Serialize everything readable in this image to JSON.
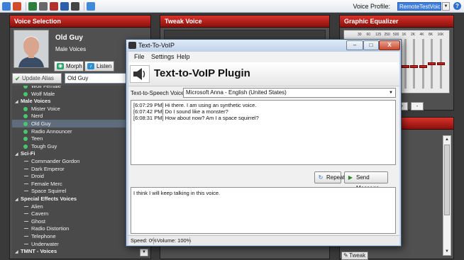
{
  "toolbar": {
    "voice_profile_label": "Voice Profile:",
    "voice_profile_value": "RemoteTestVoice",
    "help_label": "?"
  },
  "voice_panel": {
    "title": "Voice Selection",
    "voice_name": "Old Guy",
    "voice_category": "Male Voices",
    "morph_label": "Morph",
    "listen_label": "Listen",
    "update_alias_label": "Update Alias",
    "alias_value": "Old Guy",
    "tree": [
      {
        "type": "leaf",
        "label": "Wolf Female",
        "icon": "dot"
      },
      {
        "type": "leaf",
        "label": "Wolf Male",
        "icon": "dot"
      },
      {
        "type": "group",
        "label": "Male Voices"
      },
      {
        "type": "leaf",
        "label": "Mister Voice",
        "icon": "dot"
      },
      {
        "type": "leaf",
        "label": "Nerd",
        "icon": "dot"
      },
      {
        "type": "leaf",
        "label": "Old Guy",
        "icon": "dot",
        "selected": true
      },
      {
        "type": "leaf",
        "label": "Radio Announcer",
        "icon": "dot"
      },
      {
        "type": "leaf",
        "label": "Teen",
        "icon": "dot"
      },
      {
        "type": "leaf",
        "label": "Tough Guy",
        "icon": "dot"
      },
      {
        "type": "group",
        "label": "Sci-Fi"
      },
      {
        "type": "leaf",
        "label": "Commander Gordon",
        "icon": "line"
      },
      {
        "type": "leaf",
        "label": "Dark Emperor",
        "icon": "line"
      },
      {
        "type": "leaf",
        "label": "Droid",
        "icon": "line"
      },
      {
        "type": "leaf",
        "label": "Female Merc",
        "icon": "line"
      },
      {
        "type": "leaf",
        "label": "Space Squirrel",
        "icon": "line"
      },
      {
        "type": "group",
        "label": "Special Effects Voices"
      },
      {
        "type": "leaf",
        "label": "Alien",
        "icon": "line"
      },
      {
        "type": "leaf",
        "label": "Cavern",
        "icon": "line"
      },
      {
        "type": "leaf",
        "label": "Ghost",
        "icon": "line"
      },
      {
        "type": "leaf",
        "label": "Radio Distortion",
        "icon": "line"
      },
      {
        "type": "leaf",
        "label": "Telephone",
        "icon": "line"
      },
      {
        "type": "leaf",
        "label": "Underwater",
        "icon": "line"
      },
      {
        "type": "group",
        "label": "TMNT - Voices"
      }
    ]
  },
  "tweak_panel": {
    "title": "Tweak Voice",
    "tweak_button": "Tweak"
  },
  "eq_panel": {
    "title": "Graphic Equalizer",
    "bands": [
      "30",
      "60",
      "125",
      "250",
      "500",
      "1K",
      "2K",
      "4K",
      "8K",
      "16K"
    ],
    "levels": [
      0.5,
      0.5,
      0.5,
      0.5,
      0.5,
      0.45,
      0.45,
      0.45,
      0.5,
      0.5
    ],
    "plus_label": "+",
    "minus_label": "-"
  },
  "dialog": {
    "title": "Text-To-VoIP",
    "menu": [
      "File",
      "Settings",
      "Help"
    ],
    "header": "Text-to-VoIP Plugin",
    "tts_label": "Text-to-Speech Voice:",
    "tts_value": "Microsoft Anna - English (United States)",
    "log": [
      "[6:07:29 PM] Hi there.  I am using an synthetic voice.",
      "[6:07:42 PM] Do I sound like a monster?",
      "[6:08:31 PM] How about now?  Am I a space squirrel?"
    ],
    "repeat_label": "Repeat",
    "send_label": "Send Message",
    "message": "I think I will keep talking in this voice.",
    "speed": "Speed: 0%",
    "volume": "Volume: 100%",
    "minimize": "–",
    "maximize": "□",
    "close": "X"
  },
  "colors": {
    "accent_red": "#c8231d",
    "panel_bg": "#505050",
    "dot_green": "#49c76d"
  }
}
